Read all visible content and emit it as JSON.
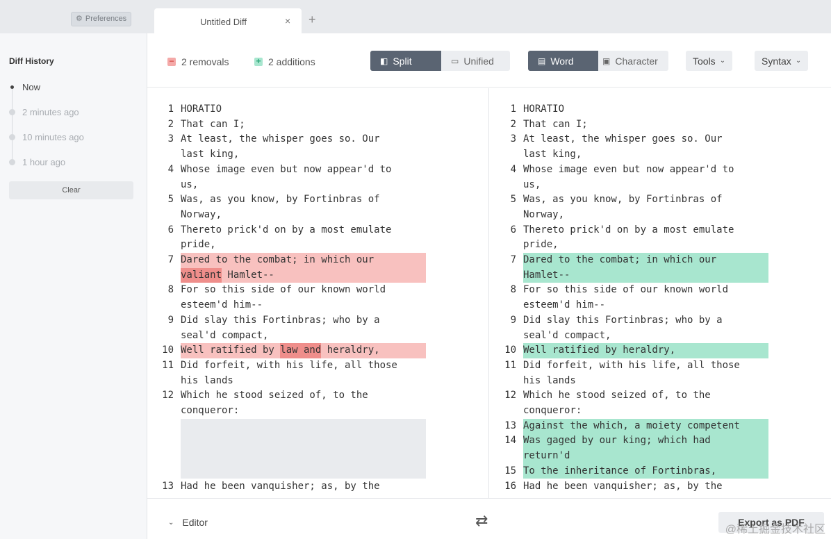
{
  "tabbar": {
    "preferences_label": "Preferences",
    "preferences_icon": "sliders-icon",
    "tab_title": "Untitled Diff",
    "tab_close": "×",
    "new_tab": "+"
  },
  "sidebar": {
    "title": "Diff History",
    "items": [
      {
        "label": "Now",
        "active": true
      },
      {
        "label": "2 minutes ago",
        "active": false
      },
      {
        "label": "10 minutes ago",
        "active": false
      },
      {
        "label": "1 hour ago",
        "active": false
      }
    ],
    "clear_label": "Clear"
  },
  "toolbar": {
    "removals": "2 removals",
    "additions": "2 additions",
    "split_label": "Split",
    "unified_label": "Unified",
    "word_label": "Word",
    "character_label": "Character",
    "tools_label": "Tools",
    "syntax_label": "Syntax"
  },
  "colors": {
    "removed_line": "#f8c1bf",
    "removed_word": "#ef8e8b",
    "added_line": "#a8e6cf",
    "active_segment": "#5a6472"
  },
  "diff": {
    "left": [
      {
        "n": "1",
        "lines": [
          "HORATIO"
        ]
      },
      {
        "n": "2",
        "lines": [
          "That can I;"
        ]
      },
      {
        "n": "3",
        "lines": [
          "At least, the whisper goes so. Our",
          "last king,"
        ]
      },
      {
        "n": "4",
        "lines": [
          "Whose image even but now appear'd to",
          "us,"
        ]
      },
      {
        "n": "5",
        "lines": [
          "Was, as you know, by Fortinbras of",
          "Norway,"
        ]
      },
      {
        "n": "6",
        "lines": [
          "Thereto prick'd on by a most emulate",
          "pride,"
        ]
      },
      {
        "n": "7",
        "lines": [
          "Dared to the combat; in which our",
          "valiant Hamlet--"
        ],
        "type": "removed"
      },
      {
        "n": "8",
        "lines": [
          "For so this side of our known world",
          "esteem'd him--"
        ]
      },
      {
        "n": "9",
        "lines": [
          "Did slay this Fortinbras; who by a",
          "seal'd compact,"
        ]
      },
      {
        "n": "10",
        "lines": [
          "Well ratified by law and heraldry,"
        ],
        "type": "removed"
      },
      {
        "n": "11",
        "lines": [
          "Did forfeit, with his life, all those",
          "his lands"
        ]
      },
      {
        "n": "12",
        "lines": [
          "Which he stood seized of, to the",
          "conqueror:"
        ]
      },
      {
        "n": "",
        "lines": [
          "",
          "",
          "",
          ""
        ],
        "type": "empty"
      },
      {
        "n": "13",
        "lines": [
          "Had he been vanquisher; as, by the"
        ]
      }
    ],
    "right": [
      {
        "n": "1",
        "lines": [
          "HORATIO"
        ]
      },
      {
        "n": "2",
        "lines": [
          "That can I;"
        ]
      },
      {
        "n": "3",
        "lines": [
          "At least, the whisper goes so. Our",
          "last king,"
        ]
      },
      {
        "n": "4",
        "lines": [
          "Whose image even but now appear'd to",
          "us,"
        ]
      },
      {
        "n": "5",
        "lines": [
          "Was, as you know, by Fortinbras of",
          "Norway,"
        ]
      },
      {
        "n": "6",
        "lines": [
          "Thereto prick'd on by a most emulate",
          "pride,"
        ]
      },
      {
        "n": "7",
        "lines": [
          "Dared to the combat; in which our",
          "Hamlet--"
        ],
        "type": "added"
      },
      {
        "n": "8",
        "lines": [
          "For so this side of our known world",
          "esteem'd him--"
        ]
      },
      {
        "n": "9",
        "lines": [
          "Did slay this Fortinbras; who by a",
          "seal'd compact,"
        ]
      },
      {
        "n": "10",
        "lines": [
          "Well ratified by heraldry,"
        ],
        "type": "added"
      },
      {
        "n": "11",
        "lines": [
          "Did forfeit, with his life, all those",
          "his lands"
        ]
      },
      {
        "n": "12",
        "lines": [
          "Which he stood seized of, to the",
          "conqueror:"
        ]
      },
      {
        "n": "13",
        "lines": [
          "Against the which, a moiety competent"
        ],
        "type": "added"
      },
      {
        "n": "14",
        "lines": [
          "Was gaged by our king; which had",
          "return'd"
        ],
        "type": "added"
      },
      {
        "n": "15",
        "lines": [
          "To the inheritance of Fortinbras,"
        ],
        "type": "added"
      },
      {
        "n": "16",
        "lines": [
          "Had he been vanquisher; as, by the"
        ]
      }
    ]
  },
  "bottombar": {
    "editor_label": "Editor",
    "swap_icon": "⇄",
    "export_label": "Export as PDF"
  },
  "watermark": "@稀土掘金技术社区"
}
